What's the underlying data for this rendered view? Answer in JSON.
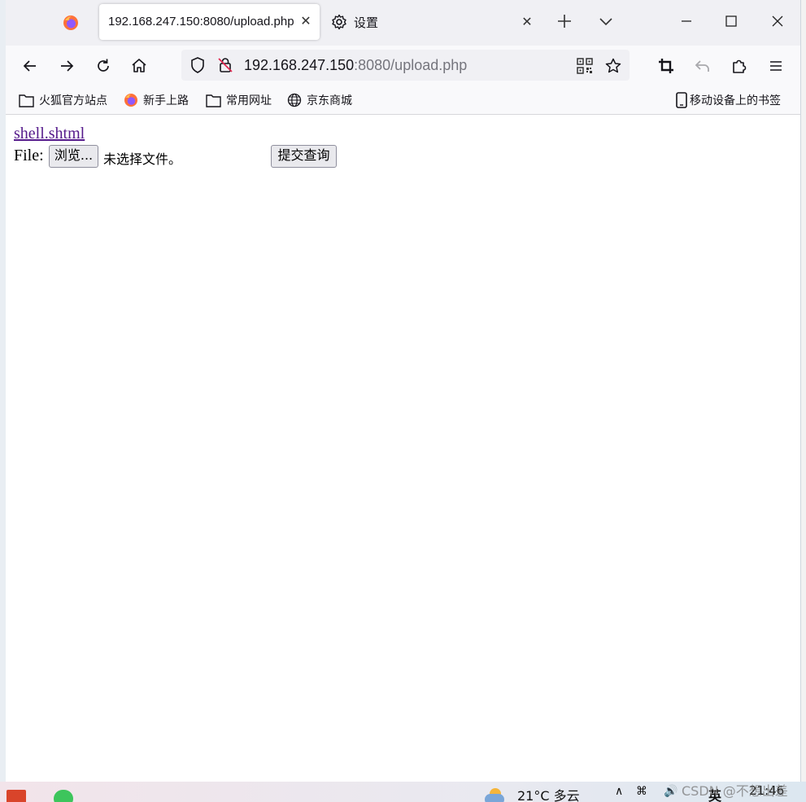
{
  "browser": {
    "active_tab": {
      "title": "192.168.247.150:8080/upload.php",
      "close": "✕"
    },
    "second_tab": {
      "title": "设置",
      "close": "✕"
    },
    "url": {
      "host": "192.168.247.150",
      "rest": ":8080/upload.php"
    },
    "bookmarks": [
      {
        "label": "火狐官方站点",
        "icon": "folder-icon"
      },
      {
        "label": "新手上路",
        "icon": "firefox-icon"
      },
      {
        "label": "常用网址",
        "icon": "folder-icon"
      },
      {
        "label": "京东商城",
        "icon": "globe-icon"
      }
    ],
    "mobile_bookmarks": "移动设备上的书签"
  },
  "page": {
    "link_text": "shell.shtml",
    "file_label": "File:",
    "browse_button": "浏览...",
    "no_file_text": "未选择文件。",
    "submit_button": "提交查询"
  },
  "taskbar": {
    "weather": "21°C 多云",
    "ime": "英",
    "time": "21:46"
  },
  "watermark": "CSDN @不想出差"
}
